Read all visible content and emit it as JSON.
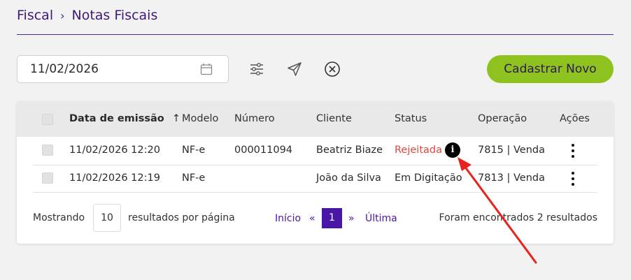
{
  "breadcrumb": {
    "root": "Fiscal",
    "separator": "›",
    "current": "Notas Fiscais"
  },
  "toolbar": {
    "date_value": "11/02/2026",
    "filter_icon": "sliders-icon",
    "send_icon": "send-icon",
    "clear_icon": "close-circle-icon",
    "new_button": "Cadastrar Novo"
  },
  "table": {
    "columns": [
      "Data de emissão",
      "Modelo",
      "Número",
      "Cliente",
      "Status",
      "Operação",
      "Ações"
    ],
    "sort_indicator": "↑",
    "rows": [
      {
        "date": "11/02/2026 12:20",
        "model": "NF-e",
        "number": "000011094",
        "client": "Beatriz Biaze",
        "status": "Rejeitada",
        "status_info": "i",
        "operation": "7815 | Venda"
      },
      {
        "date": "11/02/2026 12:19",
        "model": "NF-e",
        "number": "",
        "client": "João da Silva",
        "status": "Em Digitação",
        "operation": "7813 | Venda"
      }
    ]
  },
  "footer": {
    "showing_label": "Mostrando",
    "page_size": "10",
    "per_page_label": "resultados por página",
    "first": "Início",
    "prev": "«",
    "current_page": "1",
    "next": "»",
    "last": "Última",
    "results_text": "Foram encontrados 2 resultados"
  },
  "colors": {
    "brand": "#3d1a78",
    "primary_button": "#8dc21f",
    "pager": "#4a16a8",
    "status_rejected": "#e0463c",
    "annotation_arrow": "#e8231f"
  }
}
